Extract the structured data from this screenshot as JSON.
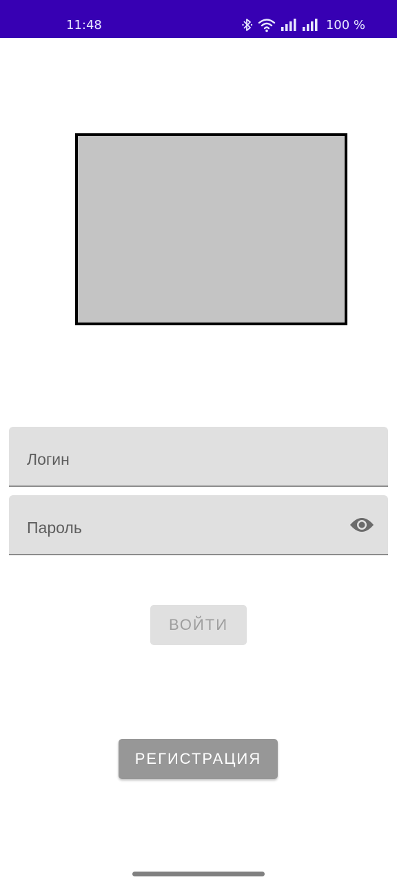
{
  "status_bar": {
    "time": "11:48",
    "battery": "100 %",
    "icons": [
      "bluetooth-icon",
      "wifi-icon",
      "signal-icon",
      "signal-icon",
      "battery-text"
    ],
    "background": "#3700b3"
  },
  "image_placeholder": {
    "fill": "#c4c4c4",
    "border": "#000000"
  },
  "login_field": {
    "label": "Логин"
  },
  "password_field": {
    "label": "Пароль",
    "toggle_icon": "eye-icon"
  },
  "buttons": {
    "login_label": "ВОЙТИ",
    "register_label": "РЕГИСТРАЦИЯ"
  }
}
